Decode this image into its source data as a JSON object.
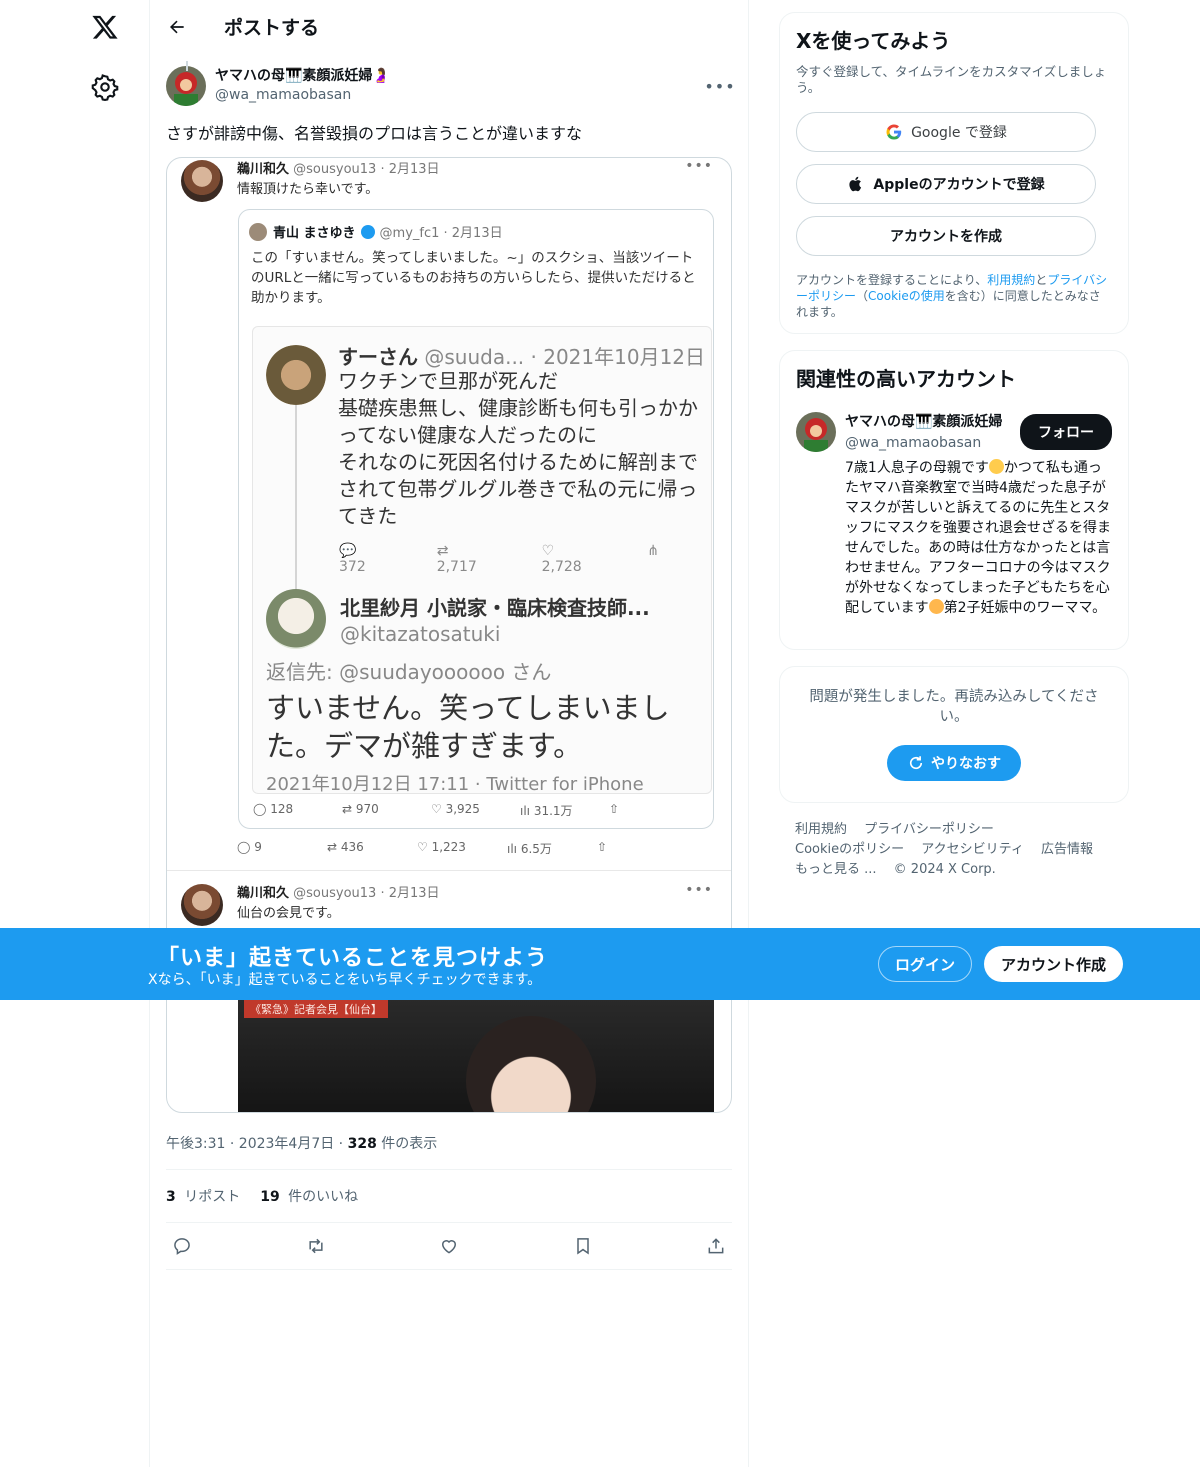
{
  "topbar": {
    "title": "ポストする"
  },
  "post": {
    "author_name": "ヤマハの母🎹素顔派妊婦🤰",
    "author_handle": "@wa_mamaobasan",
    "text": "さすが誹謗中傷、名誉毀損のプロは言うことが違いますな",
    "timestamp": "午後3:31 · 2023年4月7日 · ",
    "views_count": "328",
    "views_label": " 件の表示",
    "reposts_count": "3",
    "reposts_label": " リポスト",
    "likes_count": "19",
    "likes_label": " 件のいいね"
  },
  "embedded": {
    "tweet1": {
      "name": "鵜川和久",
      "handle": "@sousyou13 · 2月13日",
      "text": "情報頂けたら幸いです。"
    },
    "quote": {
      "name": "青山 まさゆき",
      "handle": "@my_fc1 · 2月13日",
      "text": "この「すいません。笑ってしまいました。~」のスクショ、当該ツイートのURLと一緒に写っているものお持ちの方いらしたら、提供いただけると助かります。"
    },
    "inner1": {
      "name": "すーさん",
      "handle": " @suuda... · 2021年10月12日",
      "lines": [
        "ワクチンで旦那が死んだ",
        "基礎疾患無し、健康診断も何も引っかか",
        "ってない健康な人だったのに",
        "それなのに死因名付けるために解剖まで",
        "されて包帯グルグル巻きで私の元に帰っ",
        "てきた"
      ],
      "replies": "372",
      "retweets": "2,717",
      "likes": "2,728"
    },
    "inner2": {
      "name": "北里紗月 小説家・臨床検査技師...",
      "handle": "@kitazatosatuki",
      "reply_to": "返信先: @suudayoooooo さん",
      "line1": "すいません。笑ってしまいまし",
      "line2": "た。デマが雑すぎます。",
      "footer": "2021年10月12日 17:11 · Twitter for iPhone"
    },
    "quote_stats": {
      "replies": "128",
      "retweets": "970",
      "likes": "3,925",
      "views": "31.1万"
    },
    "outer_stats": {
      "replies": "9",
      "retweets": "436",
      "likes": "1,223",
      "views": "6.5万"
    },
    "tweet2": {
      "name": "鵜川和久",
      "handle": "@sousyou13 · 2月13日",
      "text": "仙台の会見です。"
    },
    "video_label": "《緊急》記者会見【仙台】"
  },
  "signup": {
    "title": "Xを使ってみよう",
    "subtitle": "今すぐ登録して、タイムラインをカスタマイズしましょう。",
    "google_label": "Google で登録",
    "apple_label": "Appleのアカウントで登録",
    "create_label": "アカウントを作成",
    "terms_pre": "アカウントを登録することにより、",
    "terms_link1": "利用規約",
    "terms_mid1": "と",
    "terms_link2": "プライバシーポリシー",
    "terms_mid2": "（",
    "terms_link3": "Cookieの使用",
    "terms_post": "を含む）に同意したとみなされます。"
  },
  "related": {
    "title": "関連性の高いアカウント",
    "name": "ヤマハの母🎹素顔派妊婦",
    "handle": "@wa_mamaobasan",
    "follow_label": "フォロー",
    "bio_part1": "7歳1人息子の母親です",
    "bio_part2": "かつて私も通ったヤマハ音楽教室で当時4歳だった息子がマスクが苦しいと訴えてるのに先生とスタッフにマスクを強要され退会せざるを得ませんでした。あの時は仕方なかったとは言わせません。アフターコロナの今はマスクが外せなくなってしまった子どもたちを心配しています",
    "bio_part3": "第2子妊娠中のワーママ。"
  },
  "error": {
    "message": "問題が発生しました。再読み込みしてください。",
    "retry_label": "やりなおす"
  },
  "footer": {
    "links": [
      "利用規約",
      "プライバシーポリシー",
      "Cookieのポリシー",
      "アクセシビリティ",
      "広告情報",
      "もっと見る ...",
      "© 2024 X Corp."
    ]
  },
  "banner": {
    "title": "「いま」起きていることを見つけよう",
    "subtitle": "Xなら、「いま」起きていることをいち早くチェックできます。",
    "login_label": "ログイン",
    "signup_label": "アカウント作成"
  },
  "colors": {
    "accent": "#1d9bf0",
    "text": "#0f1419",
    "muted": "#536471"
  }
}
